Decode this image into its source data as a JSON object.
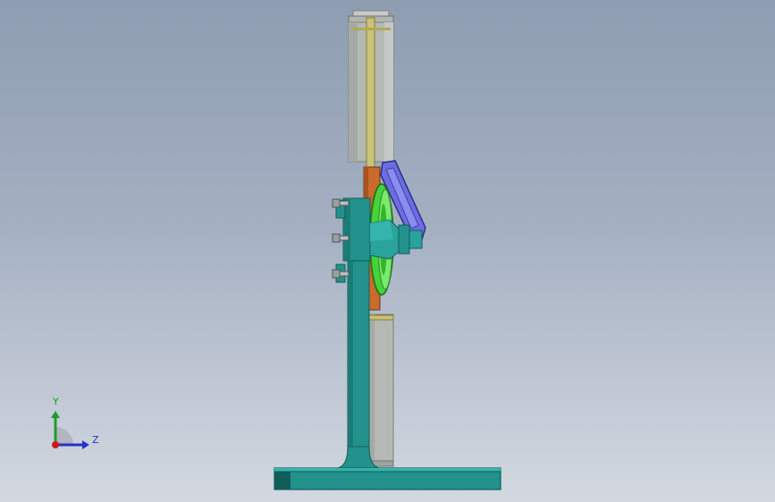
{
  "viewport": {
    "background_top": "#8e9db1",
    "background_bottom": "#d3d8e0"
  },
  "model": {
    "colors": {
      "cylinder": "#b4b9b4",
      "cylinder_shade": "#9ea49f",
      "rod": "#cbc276",
      "frame": "#23918c",
      "frame_dark": "#0f5e5a",
      "crank_plate": "#6c6ee0",
      "flywheel": "#45d23a",
      "connecting_rod": "#c86b2c",
      "bolt": "#9aa0a0"
    }
  },
  "triad": {
    "y_label": "Y",
    "z_label": "Z",
    "y_color": "#1e9a2a",
    "z_color": "#2333c8",
    "x_color": "#d01818"
  }
}
